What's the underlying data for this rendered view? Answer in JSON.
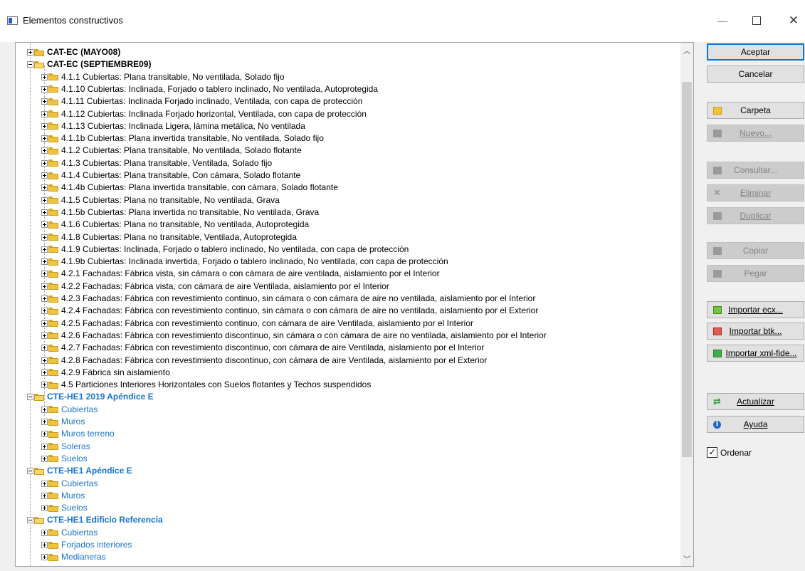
{
  "window": {
    "title": "Elementos constructivos",
    "minimize": "—",
    "close": "✕"
  },
  "tree": {
    "nodes": [
      {
        "label": "CAT-EC (MAYO08)",
        "level": 0,
        "expanded": false,
        "style": "top"
      },
      {
        "label": "CAT-EC (SEPTIEMBRE09)",
        "level": 0,
        "expanded": true,
        "style": "top"
      },
      {
        "label": "4.1.1 Cubiertas: Plana transitable, No ventilada, Solado fijo",
        "level": 1
      },
      {
        "label": "4.1.10 Cubiertas: Inclinada, Forjado o tablero inclinado, No ventilada, Autoprotegida",
        "level": 1
      },
      {
        "label": "4.1.11 Cubiertas: Inclinada Forjado inclinado, Ventilada, con capa de protección",
        "level": 1
      },
      {
        "label": "4.1.12 Cubiertas: Inclinada Forjado horizontal, Ventilada, con capa de protección",
        "level": 1
      },
      {
        "label": "4.1.13 Cubiertas: Inclinada Ligera,  lámina metálica, No ventilada",
        "level": 1
      },
      {
        "label": "4.1.1b Cubiertas: Plana invertida transitable, No ventilada, Solado fijo",
        "level": 1
      },
      {
        "label": "4.1.2 Cubiertas: Plana transitable, No ventilada, Solado flotante",
        "level": 1
      },
      {
        "label": "4.1.3 Cubiertas: Plana transitable, Ventilada, Solado fijo",
        "level": 1
      },
      {
        "label": "4.1.4 Cubiertas: Plana transitable, Con cámara, Solado flotante",
        "level": 1
      },
      {
        "label": "4.1.4b Cubiertas: Plana invertida transitable, con cámara, Solado flotante",
        "level": 1
      },
      {
        "label": "4.1.5 Cubiertas: Plana no transitable, No ventilada, Grava",
        "level": 1
      },
      {
        "label": "4.1.5b Cubiertas: Plana invertida no transitable, No ventilada, Grava",
        "level": 1
      },
      {
        "label": "4.1.6 Cubiertas: Plana no transitable, No ventilada, Autoprotegida",
        "level": 1
      },
      {
        "label": "4.1.8 Cubiertas: Plana no transitable, Ventilada, Autoprotegida",
        "level": 1
      },
      {
        "label": "4.1.9 Cubiertas: Inclinada, Forjado o tablero inclinado, No ventilada, con capa de protección",
        "level": 1
      },
      {
        "label": "4.1.9b Cubiertas: Inclinada invertida, Forjado o tablero inclinado, No ventilada, con capa de protección",
        "level": 1
      },
      {
        "label": "4.2.1 Fachadas: Fábrica vista, sin cámara o con cámara de aire ventilada, aislamiento  por el Interior",
        "level": 1
      },
      {
        "label": "4.2.2 Fachadas: Fábrica vista, con cámara de aire Ventilada, aislamiento  por el Interior",
        "level": 1
      },
      {
        "label": "4.2.3 Fachadas: Fábrica con revestimiento continuo, sin cámara o con cámara de aire no ventilada, aislamiento  por el Interior",
        "level": 1
      },
      {
        "label": "4.2.4 Fachadas: Fábrica con revestimiento continuo, sin cámara o con cámara de aire no ventilada, aislamiento  por el Exterior",
        "level": 1
      },
      {
        "label": "4.2.5 Fachadas: Fábrica con revestimiento continuo, con cámara de aire Ventilada, aislamiento por el Interior",
        "level": 1
      },
      {
        "label": "4.2.6 Fachadas: Fábrica con revestimiento discontinuo, sin cámara o con cámara de aire no ventilada, aislamiento por el Interior",
        "level": 1
      },
      {
        "label": "4.2.7 Fachadas: Fábrica con revestimiento discontinuo, con cámara de aire Ventilada, aislamiento por el Interior",
        "level": 1
      },
      {
        "label": "4.2.8 Fachadas: Fábrica con revestimiento discontinuo, con cámara de aire Ventilada, aislamiento por el Exterior",
        "level": 1
      },
      {
        "label": "4.2.9 Fábrica sin aislamiento",
        "level": 1
      },
      {
        "label": "4.5  Particiones Interiores Horizontales con Suelos flotantes y Techos suspendidos",
        "level": 1
      },
      {
        "label": "CTE-HE1 2019 Apéndice E",
        "level": 0,
        "expanded": true,
        "style": "top blue"
      },
      {
        "label": "Cubiertas",
        "level": 1,
        "style": "blue"
      },
      {
        "label": "Muros",
        "level": 1,
        "style": "blue"
      },
      {
        "label": "Muros terreno",
        "level": 1,
        "style": "blue"
      },
      {
        "label": "Soleras",
        "level": 1,
        "style": "blue"
      },
      {
        "label": "Suelos",
        "level": 1,
        "style": "blue"
      },
      {
        "label": "CTE-HE1 Apéndice E",
        "level": 0,
        "expanded": true,
        "style": "top blue"
      },
      {
        "label": "Cubiertas",
        "level": 1,
        "style": "blue"
      },
      {
        "label": "Muros",
        "level": 1,
        "style": "blue"
      },
      {
        "label": "Suelos",
        "level": 1,
        "style": "blue"
      },
      {
        "label": "CTE-HE1 Edificio Referencia",
        "level": 0,
        "expanded": true,
        "style": "top blue"
      },
      {
        "label": "Cubiertas",
        "level": 1,
        "style": "blue"
      },
      {
        "label": "Forjados interiores",
        "level": 1,
        "style": "blue"
      },
      {
        "label": "Medianeras",
        "level": 1,
        "style": "blue"
      }
    ]
  },
  "buttons": {
    "aceptar": "Aceptar",
    "cancelar": "Cancelar",
    "carpeta": "Carpeta",
    "nuevo": "Nuevo...",
    "consultar": "Consultar...",
    "eliminar": "Eliminar",
    "duplicar": "Duplicar",
    "copiar": "Copiar",
    "pegar": "Pegar",
    "importar_ecx": "Importar ecx...",
    "importar_btk": "Importar btk...",
    "importar_xml": "Importar xml-fide...",
    "actualizar": "Actualizar",
    "ayuda": "Ayuda"
  },
  "ordenar": {
    "label": "Ordenar",
    "checked": true
  },
  "colors": {
    "blue_label": "#1874cd",
    "primary_border": "#0078d7"
  }
}
